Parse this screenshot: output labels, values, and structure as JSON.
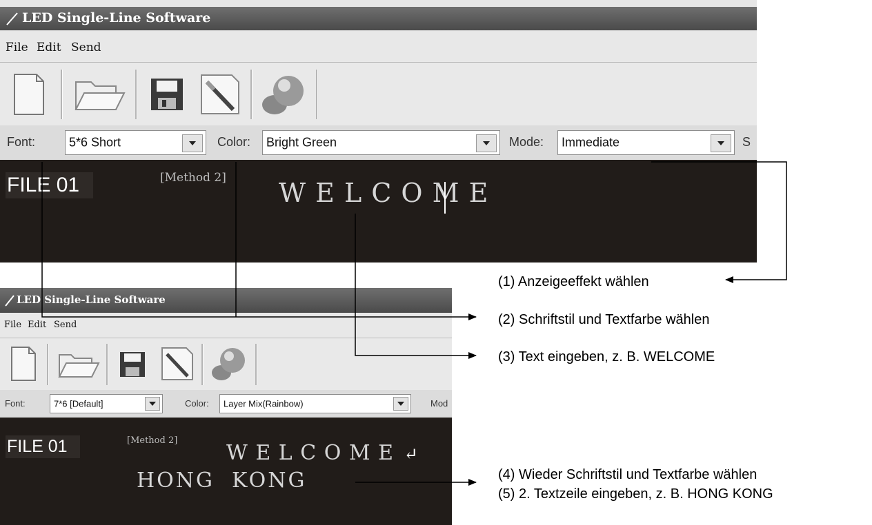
{
  "window1": {
    "title": "LED Single-Line Software",
    "menu": [
      "File",
      "Edit",
      "Send"
    ],
    "toolbar_icons": [
      "new-file-icon",
      "open-folder-icon",
      "save-disk-icon",
      "edit-brush-icon",
      "send-globe-icon"
    ],
    "font_label": "Font:",
    "font_value": "5*6 Short",
    "color_label": "Color:",
    "color_value": "Bright Green",
    "mode_label": "Mode:",
    "mode_value": "Immediate",
    "extra_label": "S",
    "file_label": "FILE 01",
    "method": "[Method 2]",
    "text_line1": "W E L C O M E"
  },
  "window2": {
    "title": "LED Single-Line Software",
    "menu": [
      "File",
      "Edit",
      "Send"
    ],
    "toolbar_icons": [
      "new-file-icon",
      "open-folder-icon",
      "save-disk-icon",
      "edit-brush-icon",
      "send-globe-icon"
    ],
    "font_label": "Font:",
    "font_value": "7*6 [Default]",
    "color_label": "Color:",
    "color_value": "Layer Mix(Rainbow)",
    "mode_label": "Mod",
    "file_label": "FILE 01",
    "method": "[Method 2]",
    "text_line1": "W E L C O M E",
    "enter_symbol": "↵",
    "text_line2": "HONG  KONG"
  },
  "callouts": [
    "(1) Anzeigeeffekt wählen",
    "(2) Schriftstil und Textfarbe wählen",
    "(3) Text eingeben, z. B. WELCOME",
    "(4) Wieder Schriftstil und Textfarbe wählen",
    "(5) 2. Textzeile eingeben, z. B. HONG KONG"
  ],
  "colors": {
    "titlebar": "#555555",
    "editor_bg": "#211c19",
    "led_text": "#d6d6d6"
  }
}
